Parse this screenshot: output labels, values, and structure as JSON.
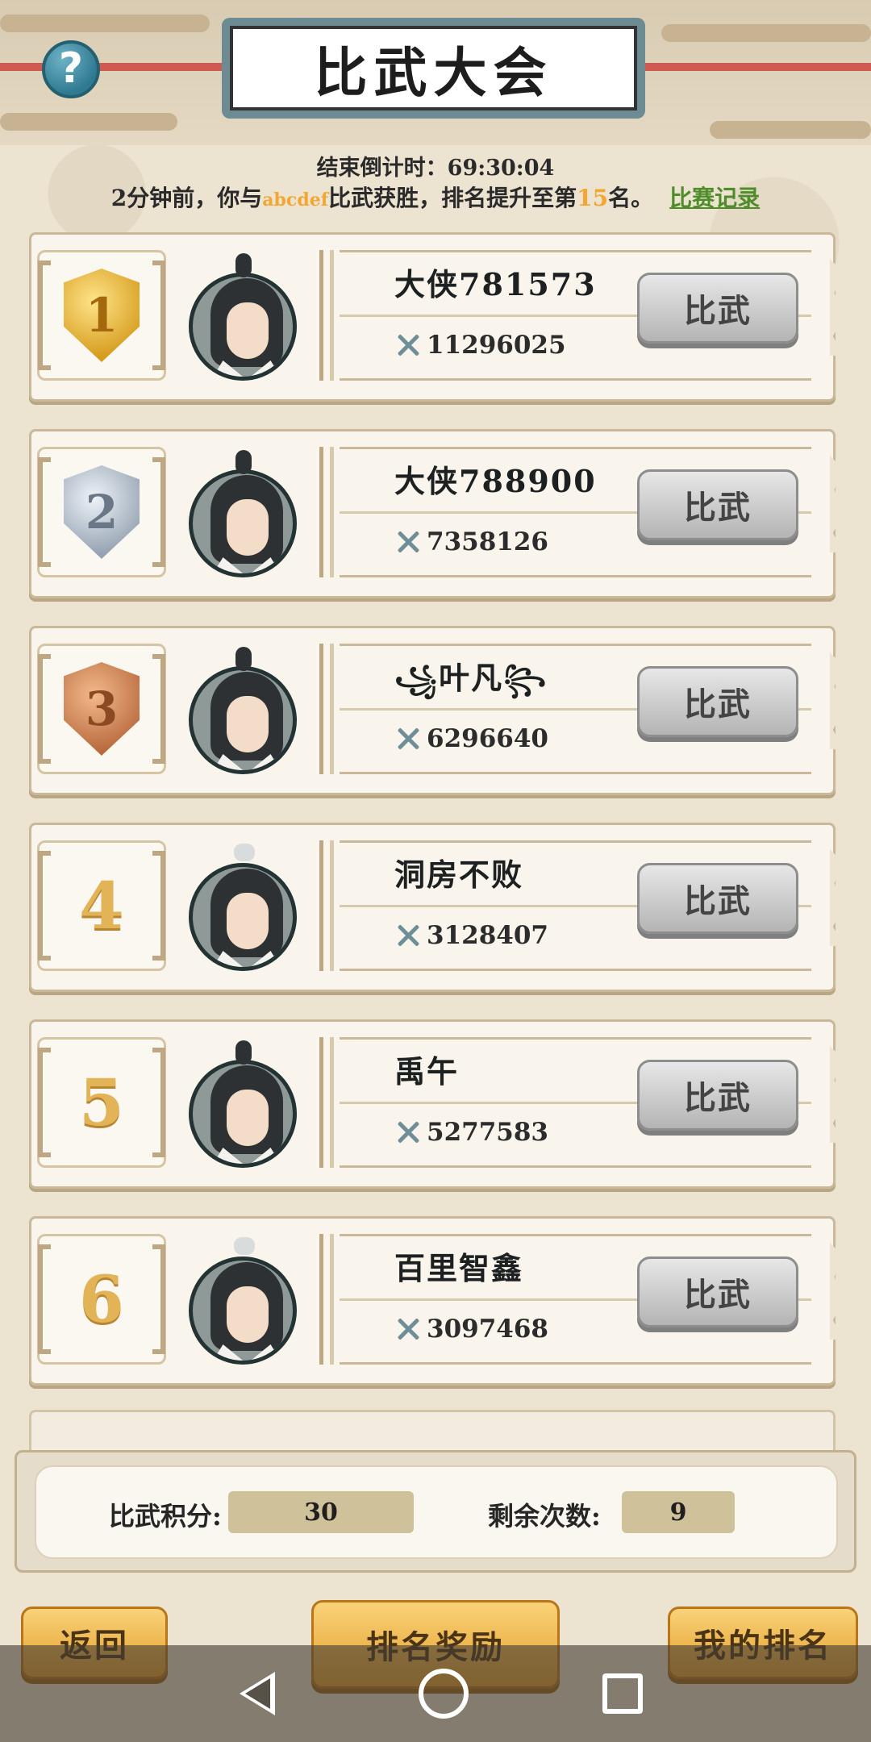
{
  "header": {
    "title": "比武大会",
    "help_symbol": "?"
  },
  "countdown": {
    "label": "结束倒计时：",
    "value": "69:30:04"
  },
  "notice": {
    "prefix": "2分钟前，你与",
    "opponent": "abcdef",
    "middle": "比武获胜，排名提升至第",
    "rank": "15",
    "suffix": "名。",
    "link": "比赛记录"
  },
  "players": [
    {
      "rank": "1",
      "name": "大侠781573",
      "power": "11296025",
      "button": "比武"
    },
    {
      "rank": "2",
      "name": "大侠788900",
      "power": "7358126",
      "button": "比武"
    },
    {
      "rank": "3",
      "name": "叶凡",
      "power": "6296640",
      "button": "比武"
    },
    {
      "rank": "4",
      "name": "洞房不败",
      "power": "3128407",
      "button": "比武"
    },
    {
      "rank": "5",
      "name": "禹午",
      "power": "5277583",
      "button": "比武"
    },
    {
      "rank": "6",
      "name": "百里智鑫",
      "power": "3097468",
      "button": "比武"
    }
  ],
  "stats": {
    "score_label": "比武积分:",
    "score_value": "30",
    "remaining_label": "剩余次数:",
    "remaining_value": "9"
  },
  "bottom": {
    "back": "返回",
    "rank_reward": "排名奖励",
    "my_rank": "我的排名"
  },
  "colors": {
    "accent_orange": "#f2a634",
    "link_green": "#4f8d2a",
    "gold": "#d59b1c",
    "silver": "#95a2b1",
    "bronze": "#b86a3d"
  }
}
